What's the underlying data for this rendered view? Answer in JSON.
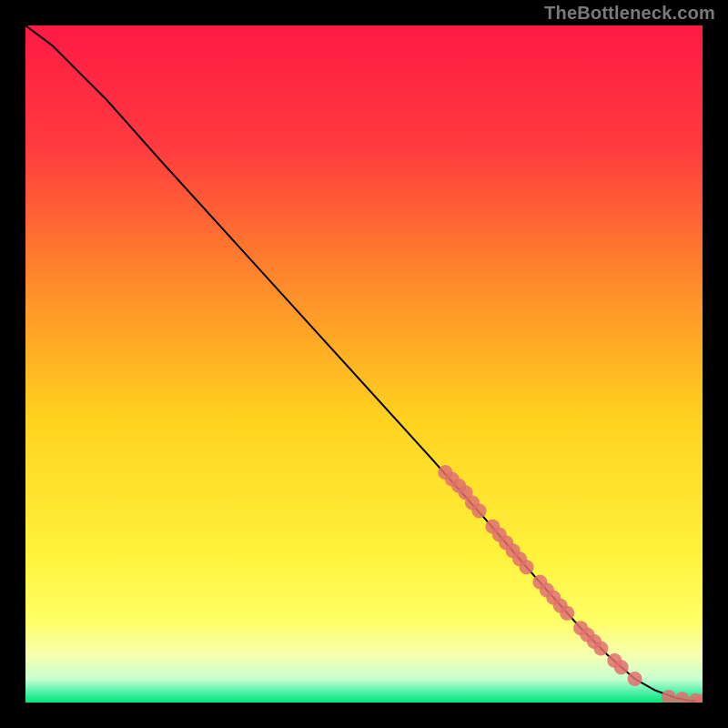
{
  "watermark": "TheBottleneck.com",
  "chart_data": {
    "type": "line",
    "title": "",
    "xlabel": "",
    "ylabel": "",
    "xlim": [
      0,
      100
    ],
    "ylim": [
      0,
      100
    ],
    "grid": false,
    "curve": {
      "x": [
        0,
        4,
        8,
        12,
        20,
        30,
        40,
        50,
        60,
        68,
        74,
        78,
        82,
        86,
        90,
        93,
        96,
        98,
        100
      ],
      "y": [
        100,
        97,
        93,
        89,
        80,
        69,
        58,
        47,
        36,
        27,
        20,
        15.5,
        11,
        7,
        3.5,
        1.8,
        0.7,
        0.3,
        0.2
      ]
    },
    "overlay_points": {
      "comment": "dense salmon markers along the lower segment of the curve",
      "x": [
        62,
        63,
        64,
        65,
        66,
        67,
        69,
        70,
        71,
        72,
        73,
        74,
        76,
        77,
        78,
        79,
        80,
        82,
        83,
        84,
        85,
        87,
        88,
        90,
        95,
        97,
        99,
        100
      ],
      "y": [
        34,
        33,
        32,
        31,
        29.5,
        28.3,
        26,
        24.8,
        23.6,
        22.4,
        21.2,
        20,
        17.8,
        16.6,
        15.5,
        14.3,
        13.2,
        11,
        10,
        9,
        8,
        6.2,
        5.2,
        3.5,
        0.8,
        0.5,
        0.3,
        0.2
      ]
    },
    "gradient_bands": [
      {
        "stop": 0.0,
        "color": "#ff1a44"
      },
      {
        "stop": 0.18,
        "color": "#ff3b3f"
      },
      {
        "stop": 0.38,
        "color": "#ff8a2a"
      },
      {
        "stop": 0.58,
        "color": "#ffd21f"
      },
      {
        "stop": 0.78,
        "color": "#fff23a"
      },
      {
        "stop": 0.88,
        "color": "#ffff66"
      },
      {
        "stop": 0.93,
        "color": "#f6ffb0"
      },
      {
        "stop": 0.965,
        "color": "#c8ffd0"
      },
      {
        "stop": 0.985,
        "color": "#4df0a8"
      },
      {
        "stop": 1.0,
        "color": "#00e57a"
      }
    ],
    "marker_color": "#e07070",
    "line_color": "#000000"
  }
}
